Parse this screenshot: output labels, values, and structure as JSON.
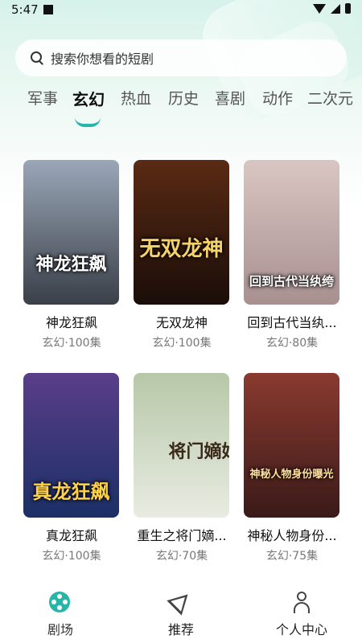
{
  "status_bar": {
    "time": "5:47"
  },
  "search": {
    "placeholder": "搜索你想看的短剧"
  },
  "tabs": [
    {
      "label": "军事"
    },
    {
      "label": "玄幻",
      "active": true
    },
    {
      "label": "热血"
    },
    {
      "label": "历史"
    },
    {
      "label": "喜剧"
    },
    {
      "label": "动作"
    },
    {
      "label": "二次元"
    }
  ],
  "dramas": [
    {
      "title": "神龙狂飙",
      "meta": "玄幻·100集",
      "poster_text": "神龙狂飙",
      "poster_colors": [
        "#9aa7b8",
        "#3a3f48"
      ]
    },
    {
      "title": "无双龙神",
      "meta": "玄幻·100集",
      "poster_text": "无双龙神",
      "poster_colors": [
        "#5a2a14",
        "#1a0d08"
      ]
    },
    {
      "title": "回到古代当纨...",
      "meta": "玄幻·80集",
      "poster_text": "回到古代当纨绔",
      "poster_colors": [
        "#d9c6c2",
        "#a88f90"
      ]
    },
    {
      "title": "真龙狂飙",
      "meta": "玄幻·100集",
      "poster_text": "真龙狂飙",
      "poster_colors": [
        "#5a3e8a",
        "#1b2f66"
      ]
    },
    {
      "title": "重生之将门嫡...",
      "meta": "玄幻·70集",
      "poster_text": "将门嫡妃",
      "poster_colors": [
        "#b7c7a8",
        "#e8ece2"
      ]
    },
    {
      "title": "神秘人物身份...",
      "meta": "玄幻·75集",
      "poster_text": "神秘人物身份曝光",
      "poster_colors": [
        "#8a3a30",
        "#3a1a18"
      ]
    }
  ],
  "bottom_nav": [
    {
      "label": "剧场",
      "icon": "theater-icon",
      "active": true
    },
    {
      "label": "推荐",
      "icon": "send-icon"
    },
    {
      "label": "个人中心",
      "icon": "person-icon"
    }
  ],
  "colors": {
    "accent": "#27b5a8"
  }
}
